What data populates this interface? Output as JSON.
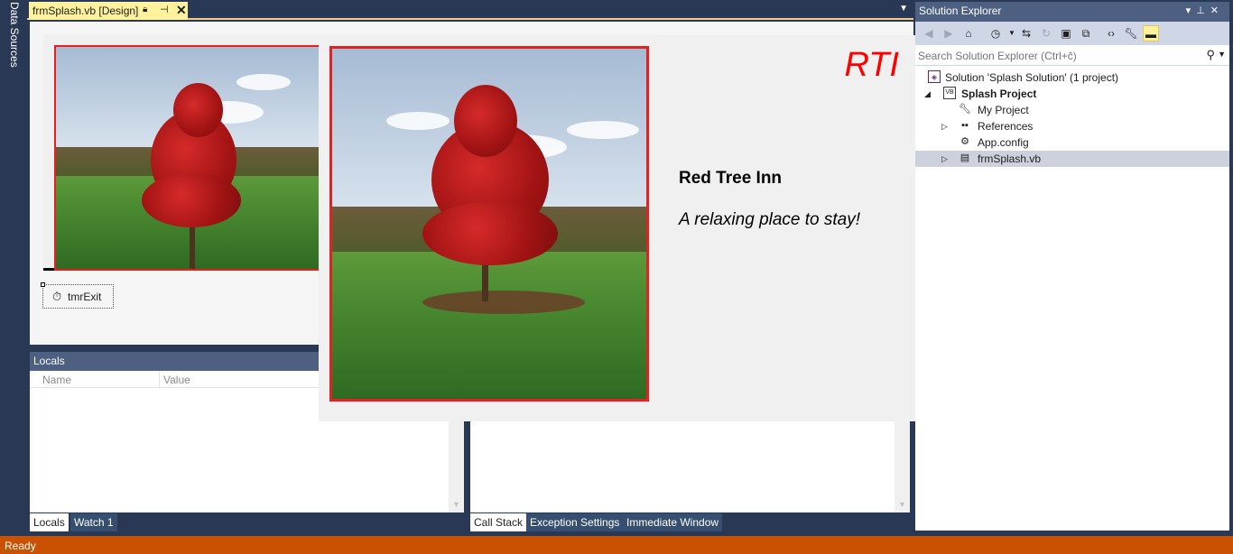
{
  "left_strip": {
    "data_sources_label": "Data Sources"
  },
  "document_tab": {
    "title": "frmSplash.vb [Design]",
    "lock_icon": "lock-icon",
    "pin_icon": "pin-icon",
    "close_icon": "close-icon"
  },
  "designer": {
    "timer_component": "tmrExit"
  },
  "splash": {
    "logo": "RTI",
    "title": "Red Tree Inn",
    "tagline": "A relaxing place to stay!",
    "border_color": "#e62020"
  },
  "locals": {
    "title": "Locals",
    "columns": [
      "Name",
      "Value"
    ],
    "tabs": [
      "Locals",
      "Watch 1"
    ]
  },
  "call_stack": {
    "tabs": [
      "Call Stack",
      "Exception Settings",
      "Immediate Window"
    ]
  },
  "solution_explorer": {
    "title": "Solution Explorer",
    "search_placeholder": "Search Solution Explorer (Ctrl+č)",
    "tree": [
      {
        "label": "Solution 'Splash Solution' (1 project)",
        "icon": "solution-icon"
      },
      {
        "label": "Splash Project",
        "icon": "vb-project-icon"
      },
      {
        "label": "My Project",
        "icon": "wrench-icon"
      },
      {
        "label": "References",
        "icon": "references-icon"
      },
      {
        "label": "App.config",
        "icon": "config-icon"
      },
      {
        "label": "frmSplash.vb",
        "icon": "form-icon"
      }
    ]
  },
  "status": {
    "text": "Ready"
  },
  "colors": {
    "accent": "#ca5100",
    "panel_title": "#4d6082",
    "active_tab": "#fff29d"
  }
}
